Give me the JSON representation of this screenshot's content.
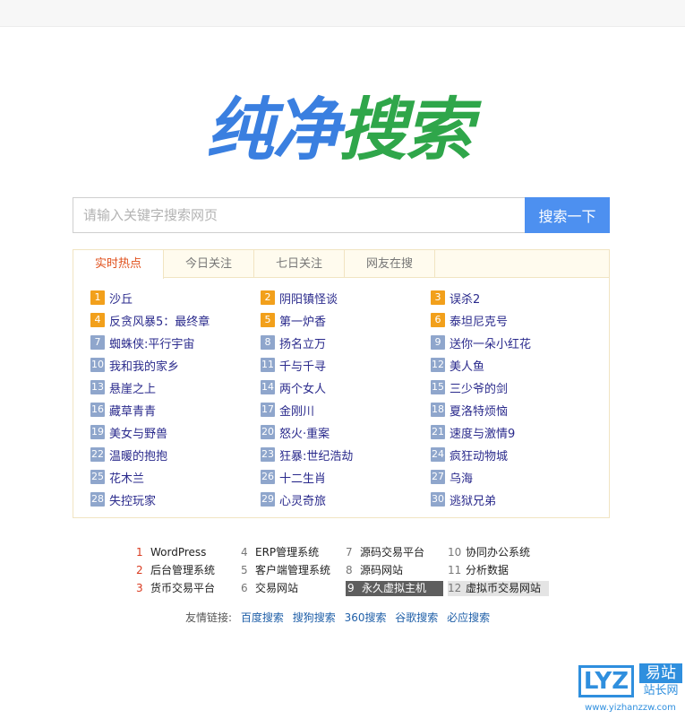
{
  "logo": {
    "part1": "纯净",
    "part2": "搜索"
  },
  "search": {
    "placeholder": "请输入关键字搜索网页",
    "button_label": "搜索一下"
  },
  "tabs": [
    {
      "label": "实时热点",
      "active": true
    },
    {
      "label": "今日关注",
      "active": false
    },
    {
      "label": "七日关注",
      "active": false
    },
    {
      "label": "网友在搜",
      "active": false
    }
  ],
  "hot_items": [
    {
      "rank": "1",
      "text": "沙丘"
    },
    {
      "rank": "2",
      "text": "阴阳镇怪谈"
    },
    {
      "rank": "3",
      "text": "误杀2"
    },
    {
      "rank": "4",
      "text": "反贪风暴5：最终章"
    },
    {
      "rank": "5",
      "text": "第一炉香"
    },
    {
      "rank": "6",
      "text": "泰坦尼克号"
    },
    {
      "rank": "7",
      "text": "蜘蛛侠:平行宇宙"
    },
    {
      "rank": "8",
      "text": "扬名立万"
    },
    {
      "rank": "9",
      "text": "送你一朵小红花"
    },
    {
      "rank": "10",
      "text": "我和我的家乡"
    },
    {
      "rank": "11",
      "text": "千与千寻"
    },
    {
      "rank": "12",
      "text": "美人鱼"
    },
    {
      "rank": "13",
      "text": "悬崖之上"
    },
    {
      "rank": "14",
      "text": "两个女人"
    },
    {
      "rank": "15",
      "text": "三少爷的剑"
    },
    {
      "rank": "16",
      "text": "藏草青青"
    },
    {
      "rank": "17",
      "text": "金刚川"
    },
    {
      "rank": "18",
      "text": "夏洛特烦恼"
    },
    {
      "rank": "19",
      "text": "美女与野兽"
    },
    {
      "rank": "20",
      "text": "怒火·重案"
    },
    {
      "rank": "21",
      "text": "速度与激情9"
    },
    {
      "rank": "22",
      "text": "温暖的抱抱"
    },
    {
      "rank": "23",
      "text": "狂暴:世纪浩劫"
    },
    {
      "rank": "24",
      "text": "疯狂动物城"
    },
    {
      "rank": "25",
      "text": "花木兰"
    },
    {
      "rank": "26",
      "text": "十二生肖"
    },
    {
      "rank": "27",
      "text": "乌海"
    },
    {
      "rank": "28",
      "text": "失控玩家"
    },
    {
      "rank": "29",
      "text": "心灵奇旅"
    },
    {
      "rank": "30",
      "text": "逃狱兄弟"
    }
  ],
  "links": [
    {
      "rank": "1",
      "text": "WordPress"
    },
    {
      "rank": "4",
      "text": "ERP管理系统"
    },
    {
      "rank": "7",
      "text": "源码交易平台"
    },
    {
      "rank": "10",
      "text": "协同办公系统"
    },
    {
      "rank": "2",
      "text": "后台管理系统"
    },
    {
      "rank": "5",
      "text": "客户端管理系统"
    },
    {
      "rank": "8",
      "text": "源码网站"
    },
    {
      "rank": "11",
      "text": "分析数据"
    },
    {
      "rank": "3",
      "text": "货币交易平台"
    },
    {
      "rank": "6",
      "text": "交易网站"
    },
    {
      "rank": "9",
      "text": "永久虚拟主机"
    },
    {
      "rank": "12",
      "text": "虚拟币交易网站"
    }
  ],
  "friends": {
    "label": "友情链接:",
    "links": [
      "百度搜索",
      "搜狗搜索",
      "360搜索",
      "谷歌搜索",
      "必应搜索"
    ]
  },
  "badge": {
    "mark": "LYZ",
    "name": "易站",
    "sub": "站长网",
    "url": "www.yizhanzzw.com"
  }
}
